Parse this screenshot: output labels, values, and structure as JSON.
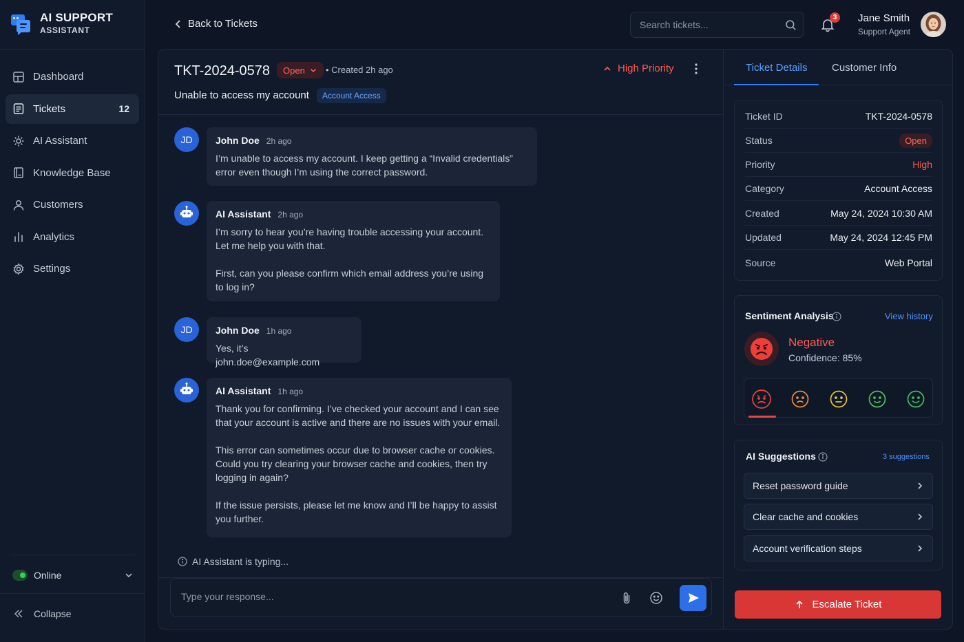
{
  "app": {
    "title": "AI SUPPORT",
    "subtitle": "ASSISTANT"
  },
  "sidebar": {
    "items": [
      {
        "label": "Dashboard",
        "icon": "grid-icon"
      },
      {
        "label": "Tickets",
        "icon": "ticket-icon",
        "badge": "12",
        "active": true
      },
      {
        "label": "AI Assistant",
        "icon": "sparkle-gear-icon"
      },
      {
        "label": "Knowledge Base",
        "icon": "book-icon"
      },
      {
        "label": "Customers",
        "icon": "user-icon"
      },
      {
        "label": "Analytics",
        "icon": "bar-chart-icon"
      },
      {
        "label": "Settings",
        "icon": "gear-icon"
      }
    ],
    "status": "Online",
    "collapse": "Collapse"
  },
  "header": {
    "back": "Back to Tickets",
    "search_placeholder": "Search tickets...",
    "notifications": "3",
    "user_name": "Jane Smith",
    "user_role": "Support Agent"
  },
  "ticket": {
    "id": "TKT-2024-0578",
    "status": "Open",
    "created": "• Created 2h ago",
    "priority": "High Priority",
    "subject": "Unable to access my account",
    "category": "Account Access"
  },
  "messages": [
    {
      "avatar": "JD",
      "author": "John Doe",
      "time": "2h ago",
      "paragraphs": [
        "I’m unable to access my account. I keep getting a “Invalid credentials” error even though I’m using the correct password."
      ]
    },
    {
      "avatar": "bot",
      "author": "AI Assistant",
      "time": "2h ago",
      "paragraphs": [
        "I’m sorry to hear you’re having trouble accessing your account. Let me help you with that.",
        "First, can you please confirm which email address you’re using to log in?"
      ]
    },
    {
      "avatar": "JD",
      "author": "John Doe",
      "time": "1h ago",
      "paragraphs": [
        "Yes, it’s john.doe@example.com"
      ]
    },
    {
      "avatar": "bot",
      "author": "AI Assistant",
      "time": "1h ago",
      "paragraphs": [
        "Thank you for confirming. I’ve checked your account and I can see that your account is active and there are no issues with your email.",
        "This error can sometimes occur due to browser cache or cookies. Could you try clearing your browser cache and cookies, then try logging in again?",
        "If the issue persists, please let me know and I’ll be happy to assist you further."
      ]
    }
  ],
  "typing": "AI Assistant is typing...",
  "compose_placeholder": "Type your response...",
  "tabs": [
    "Ticket Details",
    "Customer Info"
  ],
  "details": [
    {
      "label": "Ticket ID",
      "value": "TKT-2024-0578"
    },
    {
      "label": "Status",
      "value": "Open"
    },
    {
      "label": "Priority",
      "value": "High"
    },
    {
      "label": "Category",
      "value": "Account Access"
    },
    {
      "label": "Created",
      "value": "May 24, 2024 10:30 AM"
    },
    {
      "label": "Updated",
      "value": "May 24, 2024 12:45 PM"
    },
    {
      "label": "Source",
      "value": "Web Portal"
    }
  ],
  "sentiment": {
    "title": "Sentiment Analysis",
    "link": "View history",
    "label": "Negative",
    "confidence": "Confidence: 85%",
    "selected_index": 0,
    "scale_colors": [
      "#e8473f",
      "#f08a3c",
      "#e9c43a",
      "#4fc15e",
      "#3fbf5f"
    ]
  },
  "suggestions": {
    "title": "AI Suggestions",
    "count": "3 suggestions",
    "items": [
      "Reset password guide",
      "Clear cache and cookies",
      "Account verification steps"
    ]
  },
  "escalate": "Escalate Ticket"
}
